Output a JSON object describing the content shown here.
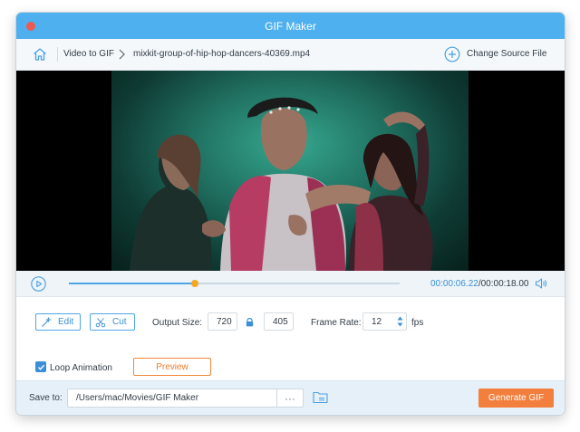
{
  "window": {
    "title": "GIF Maker"
  },
  "nav": {
    "breadcrumb_mode": "Video to GIF",
    "breadcrumb_file": "mixkit-group-of-hip-hop-dancers-40369.mp4",
    "change_source": "Change Source File",
    "icons": [
      "home-icon",
      "chevron-right-icon",
      "plus-circle-icon"
    ]
  },
  "player": {
    "current_time": "00:00:06.22",
    "separator": "/",
    "total_time": "00:00:18.00",
    "progress": 0.38,
    "colors": {
      "accent": "#4da6e3",
      "knob": "#f5a623"
    }
  },
  "settings": {
    "edit_label": "Edit",
    "cut_label": "Cut",
    "output_size_label": "Output Size:",
    "width": "720",
    "height": "405",
    "frame_rate_label": "Frame Rate:",
    "frame_rate": "12",
    "fps_label": "fps",
    "loop_label": "Loop Animation",
    "loop_checked": true,
    "preview_label": "Preview"
  },
  "footer": {
    "save_to_label": "Save to:",
    "save_path": "/Users/mac/Movies/GIF Maker",
    "browse_label": "···",
    "generate_label": "Generate GIF",
    "colors": {
      "generate": "#f27f3d"
    }
  }
}
